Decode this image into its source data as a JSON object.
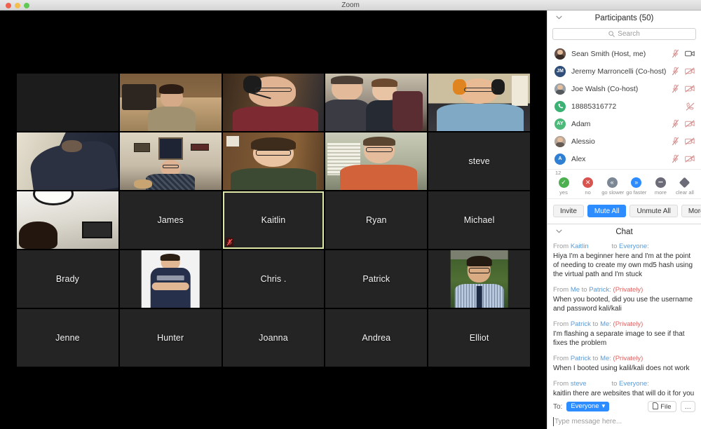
{
  "window": {
    "title": "Zoom",
    "traffic_lights": [
      "close",
      "minimize",
      "maximize"
    ]
  },
  "video_grid": {
    "tiles": [
      {
        "name": "",
        "kind": "blank",
        "row": 1,
        "col": 1
      },
      {
        "name": "",
        "kind": "video",
        "row": 1,
        "col": 2,
        "scene": "young-man-bedroom"
      },
      {
        "name": "",
        "kind": "video",
        "row": 1,
        "col": 3,
        "scene": "man-headset-glasses"
      },
      {
        "name": "",
        "kind": "video",
        "row": 1,
        "col": 4,
        "scene": "man-and-boy"
      },
      {
        "name": "",
        "kind": "video",
        "row": 1,
        "col": 5,
        "scene": "man-orange-headset"
      },
      {
        "name": "",
        "kind": "video",
        "row": 2,
        "col": 1,
        "scene": "person-dark-hoodie"
      },
      {
        "name": "",
        "kind": "video",
        "row": 2,
        "col": 2,
        "scene": "older-man-living-room"
      },
      {
        "name": "",
        "kind": "video",
        "row": 2,
        "col": 3,
        "scene": "boy-glasses-green"
      },
      {
        "name": "",
        "kind": "video",
        "row": 2,
        "col": 4,
        "scene": "man-orange-shirt-blinds"
      },
      {
        "name": "steve",
        "kind": "name",
        "row": 2,
        "col": 5
      },
      {
        "name": "",
        "kind": "video",
        "row": 3,
        "col": 1,
        "scene": "woman-white-wall"
      },
      {
        "name": "James",
        "kind": "name",
        "row": 3,
        "col": 2
      },
      {
        "name": "Kaitlin",
        "kind": "name",
        "row": 3,
        "col": 3,
        "active_speaker": true,
        "muted": true
      },
      {
        "name": "Ryan",
        "kind": "name",
        "row": 3,
        "col": 4
      },
      {
        "name": "Michael",
        "kind": "name",
        "row": 3,
        "col": 5
      },
      {
        "name": "Brady",
        "kind": "name",
        "row": 4,
        "col": 1
      },
      {
        "name": "",
        "kind": "portrait",
        "row": 4,
        "col": 2,
        "scene": "athlete-jersey"
      },
      {
        "name": "Chris .",
        "kind": "name",
        "row": 4,
        "col": 3
      },
      {
        "name": "Patrick",
        "kind": "name",
        "row": 4,
        "col": 4
      },
      {
        "name": "",
        "kind": "portrait",
        "row": 4,
        "col": 5,
        "scene": "teen-glasses-tie"
      },
      {
        "name": "Jenne",
        "kind": "name",
        "row": 5,
        "col": 1
      },
      {
        "name": "Hunter",
        "kind": "name",
        "row": 5,
        "col": 2
      },
      {
        "name": "Joanna",
        "kind": "name",
        "row": 5,
        "col": 3
      },
      {
        "name": "Andrea",
        "kind": "name",
        "row": 5,
        "col": 4
      },
      {
        "name": "Elliot",
        "kind": "name",
        "row": 5,
        "col": 5
      }
    ]
  },
  "participants_panel": {
    "title": "Participants (50)",
    "collapse_icon": "chevron-down-icon",
    "search": {
      "placeholder": "Search",
      "icon": "search-icon"
    },
    "list": [
      {
        "name": "Sean Smith (Host, me)",
        "avatar_type": "photo",
        "avatar_color": "#6a5349",
        "initials": "",
        "mic": "muted",
        "video": "on"
      },
      {
        "name": "Jeremy Marroncelli (Co-host)",
        "avatar_type": "initials",
        "avatar_color": "#2f4f7a",
        "initials": "JM",
        "mic": "muted",
        "video": "off"
      },
      {
        "name": "Joe Walsh (Co-host)",
        "avatar_type": "photo",
        "avatar_color": "#9aa3ab",
        "initials": "",
        "mic": "muted",
        "video": "off"
      },
      {
        "name": "18885316772",
        "avatar_type": "phone",
        "avatar_color": "#3bb273",
        "initials": "",
        "mic": "muted-phone",
        "video": "none"
      },
      {
        "name": "Adam",
        "avatar_type": "initials",
        "avatar_color": "#4cb87a",
        "initials": "AY",
        "mic": "muted",
        "video": "off"
      },
      {
        "name": "Alessio",
        "avatar_type": "photo",
        "avatar_color": "#b7a79a",
        "initials": "",
        "mic": "muted",
        "video": "off"
      },
      {
        "name": "Alex",
        "avatar_type": "initials",
        "avatar_color": "#2f80d2",
        "initials": "A",
        "mic": "muted",
        "video": "off"
      }
    ]
  },
  "reactions": {
    "count_badge": "12",
    "items": [
      {
        "label": "yes",
        "icon": "check-icon",
        "color": "#4caf50",
        "glyph": "✓"
      },
      {
        "label": "no",
        "icon": "x-icon",
        "color": "#d9534f",
        "glyph": "✕"
      },
      {
        "label": "go slower",
        "icon": "double-left-icon",
        "color": "#7b8794",
        "glyph": "«"
      },
      {
        "label": "go faster",
        "icon": "double-right-icon",
        "color": "#2d8cff",
        "glyph": "»"
      },
      {
        "label": "more",
        "icon": "ellipsis-icon",
        "color": "#6c6c78",
        "glyph": "•••"
      },
      {
        "label": "clear all",
        "icon": "diamond-icon",
        "color": "#6c6c78",
        "glyph": ""
      }
    ]
  },
  "actions": {
    "invite": "Invite",
    "mute_all": "Mute All",
    "unmute_all": "Unmute All",
    "more": "More",
    "more_caret": "⌄"
  },
  "chat_panel": {
    "title": "Chat",
    "collapse_icon": "chevron-down-icon",
    "messages": [
      {
        "from_label": "From",
        "sender": "Kaitlin",
        "to_label": "to",
        "recipient": "Everyone",
        "private": "",
        "colon": ":",
        "text": "Hiya I'm a beginner here and I'm at the point of needing to create my own md5 hash using the virtual path and I'm stuck"
      },
      {
        "from_label": "From",
        "sender": "Me",
        "to_label": "to",
        "recipient": "Patrick",
        "private": "(Privately)",
        "colon": ":",
        "text": "When you booted, did you use the username and password kali/kali"
      },
      {
        "from_label": "From",
        "sender": "Patrick",
        "to_label": "to",
        "recipient": "Me",
        "private": "(Privately)",
        "colon": ":",
        "text": "I'm flashing a separate image to see if that fixes the problem"
      },
      {
        "from_label": "From",
        "sender": "Patrick",
        "to_label": "to",
        "recipient": "Me",
        "private": "(Privately)",
        "colon": ":",
        "text": "When I booted using kalil/kali does not work"
      },
      {
        "from_label": "From",
        "sender": "steve",
        "to_label": "to",
        "recipient": "Everyone",
        "private": "",
        "colon": ":",
        "text": "kaitlin there are websites that will do it for you"
      }
    ],
    "footer": {
      "to_label": "To:",
      "to_value": "Everyone",
      "to_caret": "▾",
      "file_button": "File",
      "file_icon": "file-icon",
      "more_button": "…",
      "input_placeholder": "Type message here..."
    }
  }
}
